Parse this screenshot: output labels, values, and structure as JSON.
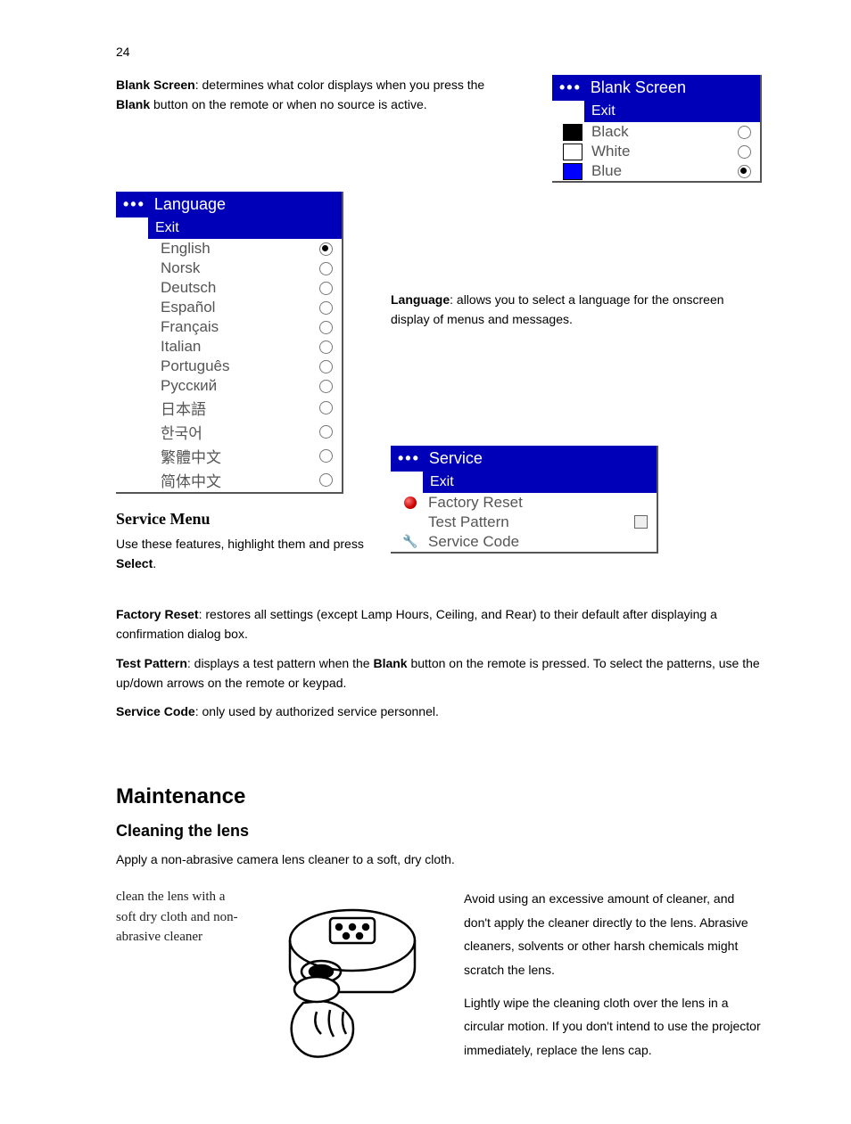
{
  "page_number": "24",
  "blank_screen_para": {
    "bold1": "Blank Screen",
    "text1": ": determines what color displays when you press the ",
    "bold2": "Blank",
    "text2": " button on the remote or when no source is active."
  },
  "blank_screen_menu": {
    "title": "Blank Screen",
    "exit": "Exit",
    "rows": [
      {
        "label": "Black",
        "swatch": "#000000",
        "selected": false
      },
      {
        "label": "White",
        "swatch": "#ffffff",
        "selected": false
      },
      {
        "label": "Blue",
        "swatch": "#0000ff",
        "selected": true
      }
    ]
  },
  "language_menu": {
    "title": "Language",
    "exit": "Exit",
    "rows": [
      {
        "label": "English",
        "selected": true
      },
      {
        "label": "Norsk",
        "selected": false
      },
      {
        "label": "Deutsch",
        "selected": false
      },
      {
        "label": "Español",
        "selected": false
      },
      {
        "label": "Français",
        "selected": false
      },
      {
        "label": "Italian",
        "selected": false
      },
      {
        "label": "Português",
        "selected": false
      },
      {
        "label": "Русский",
        "selected": false
      },
      {
        "label": "日本語",
        "selected": false
      },
      {
        "label": "한국어",
        "selected": false
      },
      {
        "label": "繁體中文",
        "selected": false
      },
      {
        "label": "简体中文",
        "selected": false
      }
    ]
  },
  "language_para": {
    "bold": "Language",
    "text": ": allows you to select a language for the onscreen display of menus and messages."
  },
  "service_menu_heading": "Service Menu",
  "service_menu_para": {
    "text1": "Use these features, highlight them and press ",
    "bold": "Select",
    "text2": "."
  },
  "service_menu": {
    "title": "Service",
    "exit": "Exit",
    "rows": [
      {
        "label": "Factory Reset",
        "icon": "red-dot"
      },
      {
        "label": "Test Pattern",
        "icon": "",
        "checkbox": true
      },
      {
        "label": "Service Code",
        "icon": "wrench"
      }
    ]
  },
  "factory_reset_para": {
    "bold": "Factory Reset",
    "text": ": restores all settings (except Lamp Hours, Ceiling, and Rear) to their default after displaying a confirmation dialog box."
  },
  "test_pattern_para": {
    "bold1": "Test Pattern",
    "text1": ": displays a test pattern when the ",
    "bold2": "Blank",
    "text2": " button on the remote is pressed. To select the patterns, use the up/down arrows on the remote or keypad."
  },
  "service_code_para": {
    "bold": "Service Code",
    "text": ": only used by authorized service personnel."
  },
  "maintenance_heading": "Maintenance",
  "cleaning_heading": "Cleaning the lens",
  "cleaning_intro": "Apply a non-abrasive camera lens cleaner to a soft, dry cloth.",
  "lens_caption": "clean the lens with a soft dry cloth and non-abrasive cleaner",
  "lens_right_p1": "Avoid using an excessive amount of cleaner, and don't apply the cleaner directly to the lens. Abrasive cleaners, solvents or other harsh chemicals might scratch the lens.",
  "lens_right_p2": "Lightly wipe the cleaning cloth over the lens in a circular motion. If you don't intend to use the projector immediately, replace the lens cap."
}
